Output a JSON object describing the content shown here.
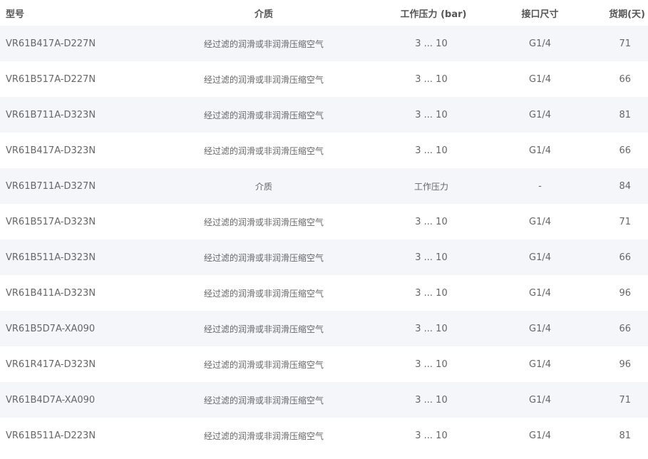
{
  "table": {
    "headers": {
      "model": "型号",
      "medium": "介质",
      "pressure": "工作压力 (bar)",
      "port": "接口尺寸",
      "lead_time": "货期(天)"
    },
    "rows": [
      {
        "model": "VR61B417A-D227N",
        "medium": "经过滤的润滑或非润滑压缩空气",
        "pressure": "3 ... 10",
        "port": "G1/4",
        "lead_time": "71"
      },
      {
        "model": "VR61B517A-D227N",
        "medium": "经过滤的润滑或非润滑压缩空气",
        "pressure": "3 ... 10",
        "port": "G1/4",
        "lead_time": "66"
      },
      {
        "model": "VR61B711A-D323N",
        "medium": "经过滤的润滑或非润滑压缩空气",
        "pressure": "3 ... 10",
        "port": "G1/4",
        "lead_time": "81"
      },
      {
        "model": "VR61B417A-D323N",
        "medium": "经过滤的润滑或非润滑压缩空气",
        "pressure": "3 ... 10",
        "port": "G1/4",
        "lead_time": "66"
      },
      {
        "model": "VR61B711A-D327N",
        "medium": "介质",
        "pressure": "工作压力",
        "port": "-",
        "lead_time": "84"
      },
      {
        "model": "VR61B517A-D323N",
        "medium": "经过滤的润滑或非润滑压缩空气",
        "pressure": "3 ... 10",
        "port": "G1/4",
        "lead_time": "71"
      },
      {
        "model": "VR61B511A-D323N",
        "medium": "经过滤的润滑或非润滑压缩空气",
        "pressure": "3 ... 10",
        "port": "G1/4",
        "lead_time": "66"
      },
      {
        "model": "VR61B411A-D323N",
        "medium": "经过滤的润滑或非润滑压缩空气",
        "pressure": "3 ... 10",
        "port": "G1/4",
        "lead_time": "96"
      },
      {
        "model": "VR61B5D7A-XA090",
        "medium": "经过滤的润滑或非润滑压缩空气",
        "pressure": "3 ... 10",
        "port": "G1/4",
        "lead_time": "66"
      },
      {
        "model": "VR61R417A-D323N",
        "medium": "经过滤的润滑或非润滑压缩空气",
        "pressure": "3 ... 10",
        "port": "G1/4",
        "lead_time": "96"
      },
      {
        "model": "VR61B4D7A-XA090",
        "medium": "经过滤的润滑或非润滑压缩空气",
        "pressure": "3 ... 10",
        "port": "G1/4",
        "lead_time": "71"
      },
      {
        "model": "VR61B511A-D223N",
        "medium": "经过滤的润滑或非润滑压缩空气",
        "pressure": "3 ... 10",
        "port": "G1/4",
        "lead_time": "81"
      }
    ]
  }
}
